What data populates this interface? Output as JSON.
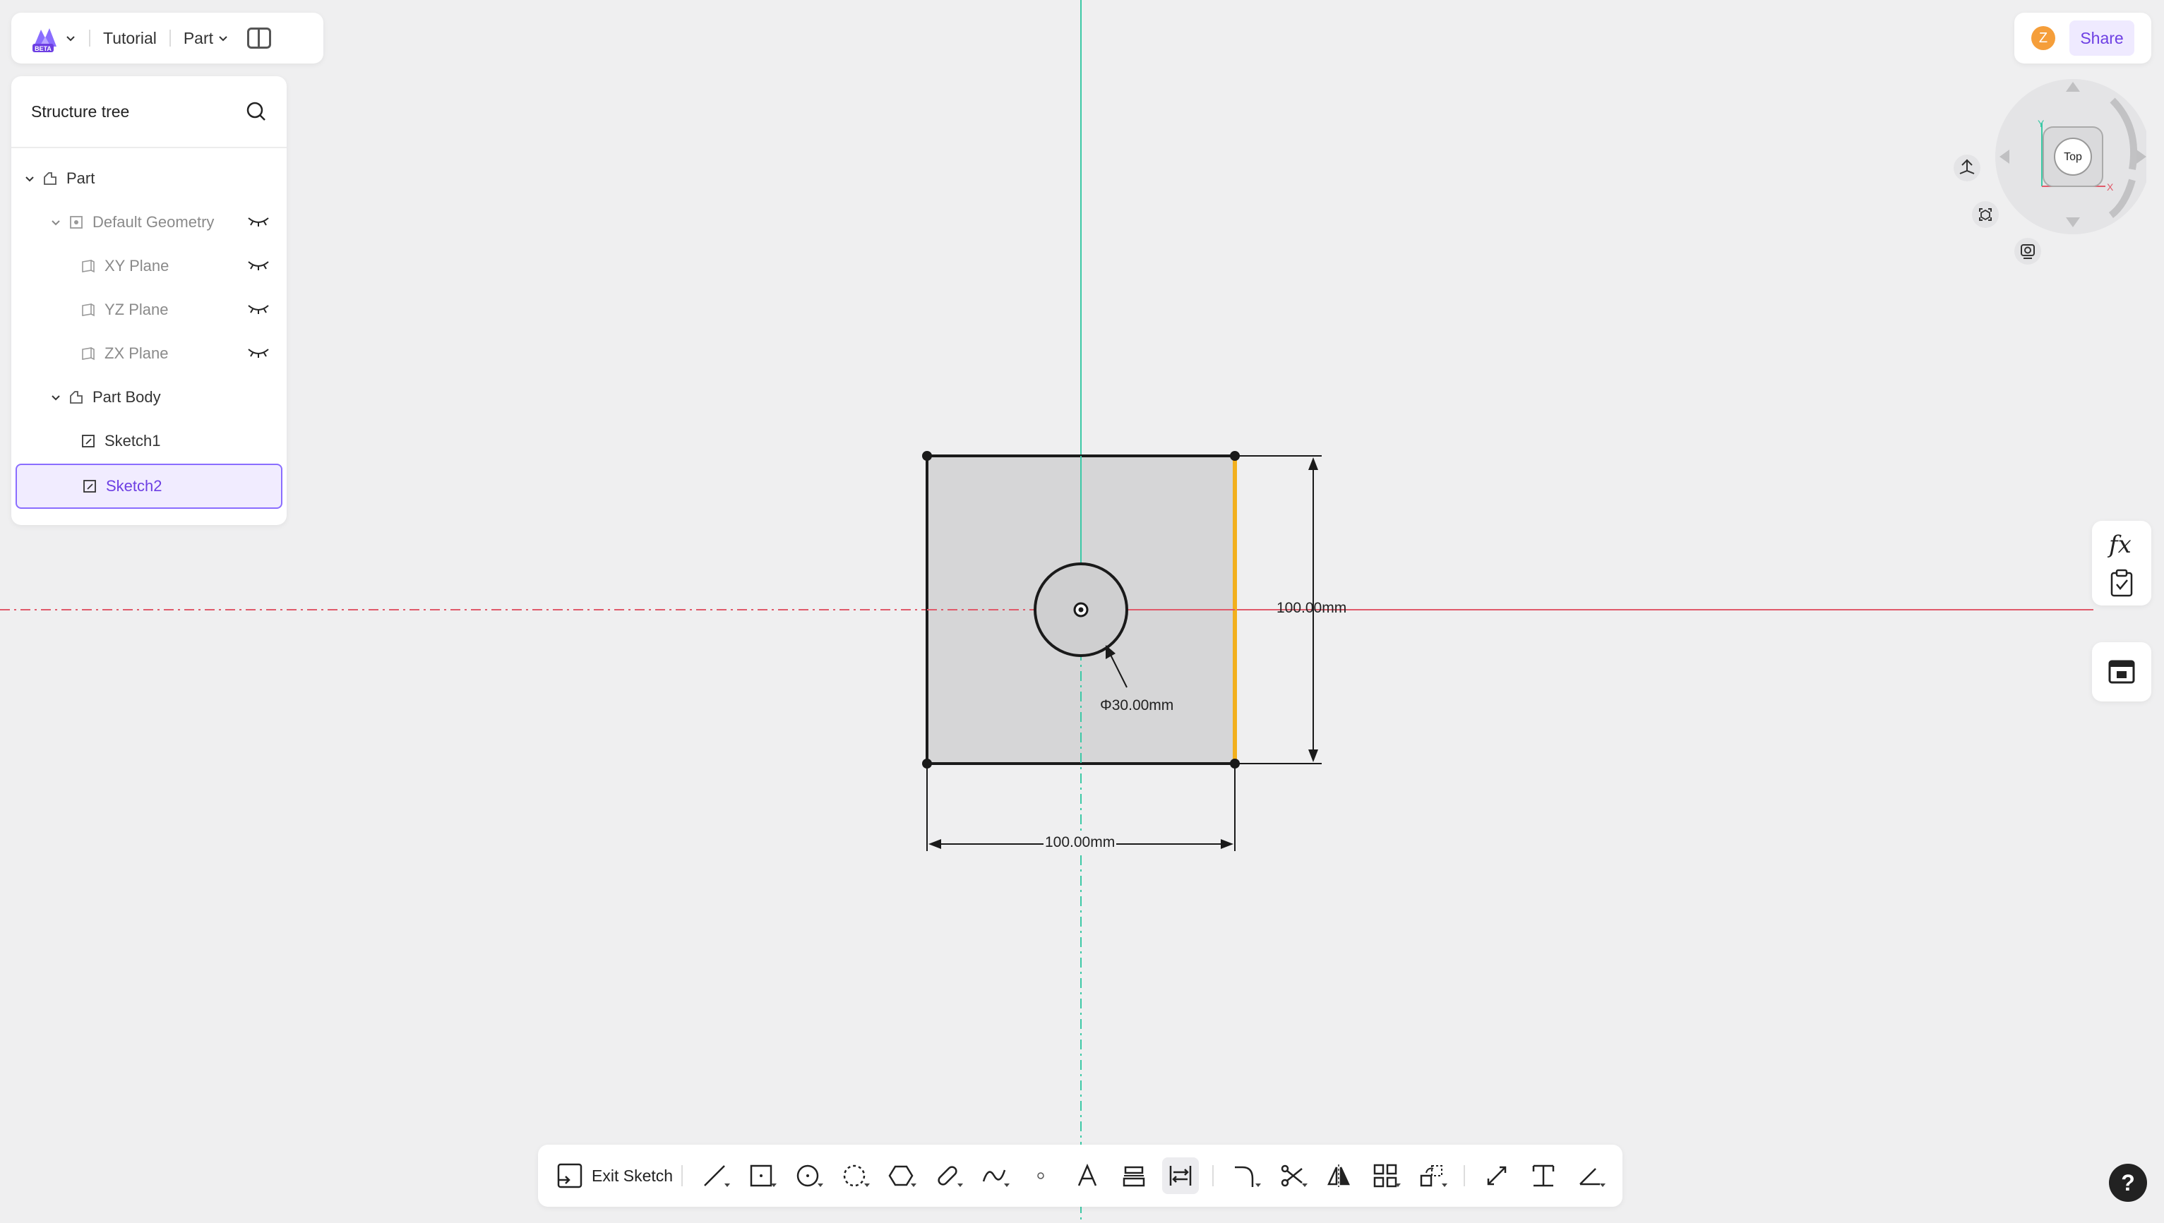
{
  "header": {
    "project": "Tutorial",
    "mode": "Part",
    "logo_badge": "BETA"
  },
  "tree": {
    "title": "Structure tree",
    "items": [
      {
        "label": "Part"
      },
      {
        "label": "Default Geometry"
      },
      {
        "label": "XY Plane"
      },
      {
        "label": "YZ Plane"
      },
      {
        "label": "ZX Plane"
      },
      {
        "label": "Part Body"
      },
      {
        "label": "Sketch1"
      },
      {
        "label": "Sketch2"
      }
    ]
  },
  "user": {
    "initial": "Z",
    "share_label": "Share"
  },
  "viewcube": {
    "face": "Top",
    "axis_y": "Y",
    "axis_x": "X"
  },
  "sketch": {
    "dim_height": "100.00mm",
    "dim_width": "100.00mm",
    "dim_diameter": "Φ30.00mm"
  },
  "toolbar": {
    "exit_label": "Exit Sketch"
  },
  "side": {
    "fx_label": "fx"
  },
  "help_label": "?",
  "colors": {
    "accent": "#6d3fe3",
    "selected_edge": "#f2b01e",
    "x_axis": "#e05a6a",
    "y_axis": "#3cc9a6"
  }
}
